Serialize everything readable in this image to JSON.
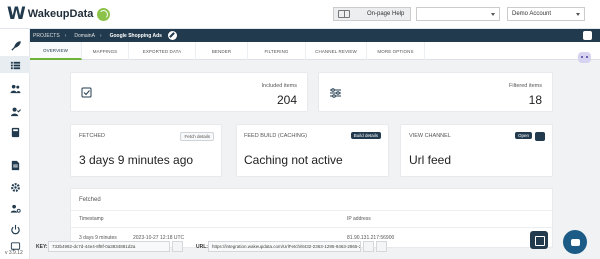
{
  "brand": {
    "name": "WakeupData"
  },
  "header": {
    "help_label": "On-page Help",
    "first_select_value": "",
    "account_select_value": "Demo Account"
  },
  "breadcrumb": {
    "items": [
      "PROJECTS",
      "DomainA",
      "Google Shopping Ads"
    ]
  },
  "tabs": [
    "OVERVIEW",
    "MAPPINGS",
    "EXPORTED DATA",
    "BENDER",
    "FILTERING",
    "CHANNEL REVIEW",
    "MORE OPTIONS"
  ],
  "stats": {
    "included_label": "Included items",
    "included_value": "204",
    "filtered_label": "Filtered items",
    "filtered_value": "18"
  },
  "fetched_card": {
    "title": "FETCHED",
    "button": "Fetch details",
    "value": "3 days 9 minutes ago"
  },
  "feed_build_card": {
    "title": "FEED BUILD (CACHING)",
    "button": "Build details",
    "value": "Caching not active"
  },
  "view_channel_card": {
    "title": "VIEW CHANNEL",
    "button": "Open",
    "value": "Url feed"
  },
  "fetched_table": {
    "title": "Fetched",
    "col_timestamp": "Timestamp",
    "col_ip": "IP address",
    "row_relative": "3 days 9 minutes",
    "row_timestamp": "2023-10-27 12:18 UTC",
    "row_ip": "81.90.131.217:56900"
  },
  "bottom": {
    "key_label": "KEY:",
    "key_value": "733b4982-dc7d-44e4-8f8f-0a3834881d2a",
    "url_label": "URL:",
    "url_value": "https://integration.wakeupdata.com/UrlFetch/8432-2363-1295-9463-2865-2982"
  },
  "version": "v 3.9.12",
  "colors": {
    "navy": "#213a4d",
    "accent_green": "#6fb33a"
  }
}
